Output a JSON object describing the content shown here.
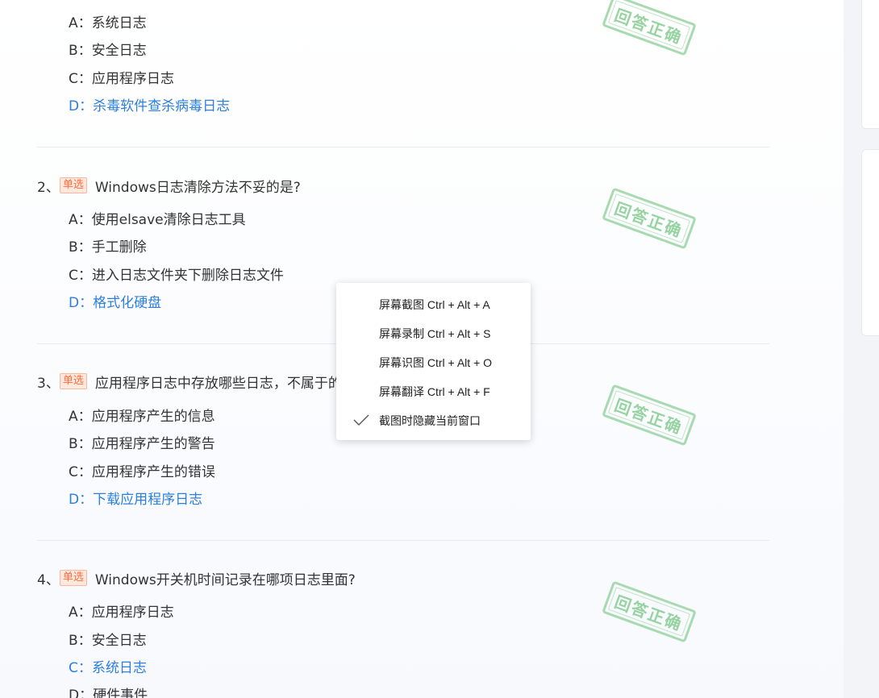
{
  "questions": [
    {
      "options": [
        {
          "letter": "A：",
          "text": "系统日志"
        },
        {
          "letter": "B：",
          "text": "安全日志"
        },
        {
          "letter": "C：",
          "text": "应用程序日志"
        },
        {
          "letter": "D：",
          "text": "杀毒软件查杀病毒日志"
        }
      ],
      "stamp": "回答正确"
    },
    {
      "number": "2、",
      "tag": "单选",
      "title": "Windows日志清除方法不妥的是?",
      "options": [
        {
          "letter": "A：",
          "text": "使用elsave清除日志工具"
        },
        {
          "letter": "B：",
          "text": "手工删除"
        },
        {
          "letter": "C：",
          "text": "进入日志文件夹下删除日志文件"
        },
        {
          "letter": "D：",
          "text": "格式化硬盘"
        }
      ],
      "stamp": "回答正确"
    },
    {
      "number": "3、",
      "tag": "单选",
      "title": "应用程序日志中存放哪些日志，不属于的是?",
      "options": [
        {
          "letter": "A：",
          "text": "应用程序产生的信息"
        },
        {
          "letter": "B：",
          "text": "应用程序产生的警告"
        },
        {
          "letter": "C：",
          "text": "应用程序产生的错误"
        },
        {
          "letter": "D：",
          "text": "下载应用程序日志"
        }
      ],
      "stamp": "回答正确"
    },
    {
      "number": "4、",
      "tag": "单选",
      "title": "Windows开关机时间记录在哪项日志里面?",
      "options": [
        {
          "letter": "A：",
          "text": "应用程序日志"
        },
        {
          "letter": "B：",
          "text": "安全日志"
        },
        {
          "letter": "C：",
          "text": "系统日志"
        },
        {
          "letter": "D：",
          "text": "硬件事件"
        }
      ],
      "stamp": "回答正确"
    }
  ],
  "context_menu": {
    "items": [
      {
        "label": "屏幕截图 Ctrl + Alt + A",
        "checked": false
      },
      {
        "label": "屏幕录制 Ctrl + Alt + S",
        "checked": false
      },
      {
        "label": "屏幕识图 Ctrl + Alt + O",
        "checked": false
      },
      {
        "label": "屏幕翻译 Ctrl + Alt + F",
        "checked": false
      },
      {
        "label": "截图时隐藏当前窗口",
        "checked": true
      }
    ]
  },
  "colors": {
    "correct_answer": "#2b7fde",
    "tag_text": "#ff6b3d",
    "stamp": "#8ccf97"
  },
  "icons": [
    "checkmark-icon"
  ]
}
